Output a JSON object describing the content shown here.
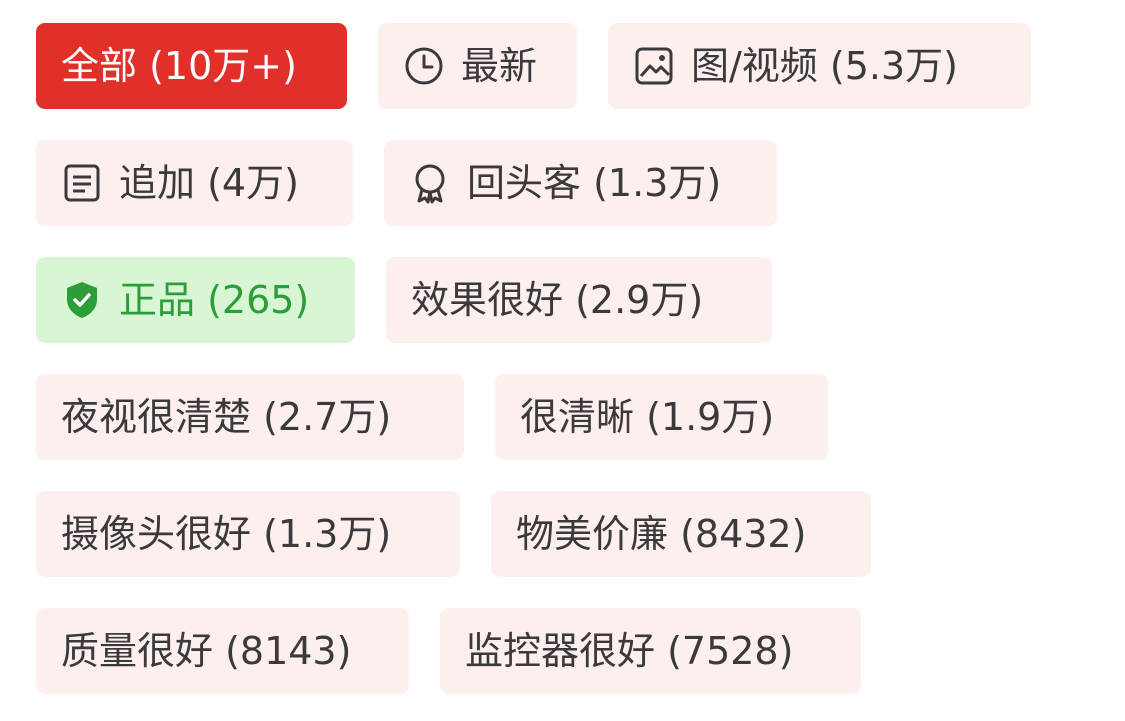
{
  "filters": {
    "all": {
      "label": "全部 (10万+)",
      "active": true
    },
    "latest": {
      "label": "最新",
      "icon": "clock-icon"
    },
    "media": {
      "label": "图/视频 (5.3万)",
      "icon": "image-icon"
    },
    "followup": {
      "label": "追加 (4万)",
      "icon": "document-icon"
    },
    "repeat": {
      "label": "回头客 (1.3万)",
      "icon": "badge-icon"
    },
    "genuine": {
      "label": "正品 (265)",
      "icon": "shield-check-icon"
    },
    "tags": [
      {
        "label": "效果很好 (2.9万)"
      },
      {
        "label": "夜视很清楚 (2.7万)"
      },
      {
        "label": "很清晰 (1.9万)"
      },
      {
        "label": "摄像头很好 (1.3万)"
      },
      {
        "label": "物美价廉 (8432)"
      },
      {
        "label": "质量很好 (8143)"
      },
      {
        "label": "监控器很好 (7528)"
      }
    ]
  },
  "colors": {
    "active_bg": "#e1302a",
    "tag_bg": "#fdefee",
    "tag_text": "#3a3a3a",
    "genuine_bg": "#d9f6d4",
    "genuine_text": "#2c9d38"
  }
}
